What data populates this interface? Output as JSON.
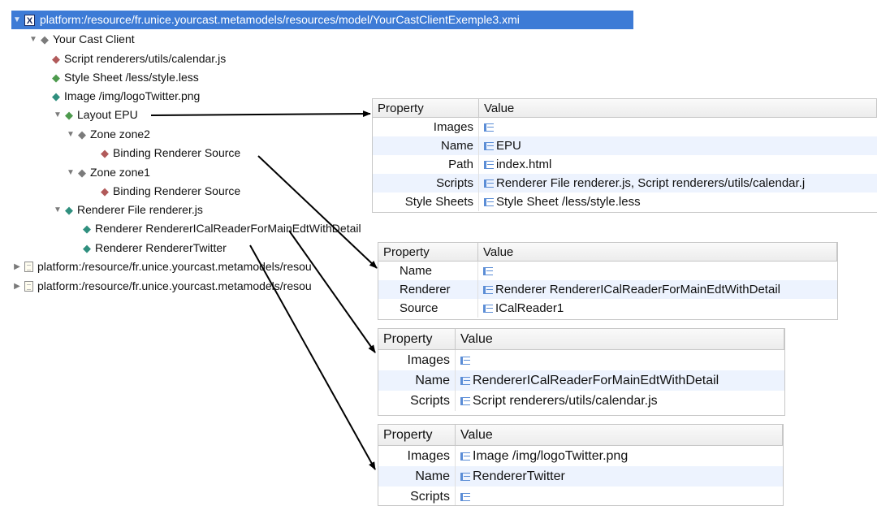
{
  "tree": {
    "root_label": "platform:/resource/fr.unice.yourcast.metamodels/resources/model/YourCastClientExemple3.xmi",
    "client": "Your Cast Client",
    "script": "Script renderers/utils/calendar.js",
    "stylesheet": "Style Sheet /less/style.less",
    "image": "Image /img/logoTwitter.png",
    "layout": "Layout EPU",
    "zone2": "Zone zone2",
    "binding_a": "Binding Renderer Source",
    "zone1": "Zone zone1",
    "binding_b": "Binding Renderer Source",
    "renderer_file": "Renderer File renderer.js",
    "renderer_ical": "Renderer RendererICalReaderForMainEdtWithDetail",
    "renderer_twitter": "Renderer RendererTwitter",
    "other_res_1": "platform:/resource/fr.unice.yourcast.metamodels/resou",
    "other_res_2": "platform:/resource/fr.unice.yourcast.metamodels/resou"
  },
  "panels": {
    "layout": {
      "header_property": "Property",
      "header_value": "Value",
      "rows": [
        {
          "key": "Images",
          "value": ""
        },
        {
          "key": "Name",
          "value": "EPU"
        },
        {
          "key": "Path",
          "value": "index.html"
        },
        {
          "key": "Scripts",
          "value": "Renderer File renderer.js, Script renderers/utils/calendar.j"
        },
        {
          "key": "Style Sheets",
          "value": "Style Sheet /less/style.less"
        }
      ]
    },
    "binding": {
      "header_property": "Property",
      "header_value": "Value",
      "rows": [
        {
          "key": "Name",
          "value": ""
        },
        {
          "key": "Renderer",
          "value": "Renderer RendererICalReaderForMainEdtWithDetail"
        },
        {
          "key": "Source",
          "value": "ICalReader1"
        }
      ]
    },
    "ical": {
      "header_property": "Property",
      "header_value": "Value",
      "rows": [
        {
          "key": "Images",
          "value": ""
        },
        {
          "key": "Name",
          "value": "RendererICalReaderForMainEdtWithDetail"
        },
        {
          "key": "Scripts",
          "value": "Script renderers/utils/calendar.js"
        }
      ]
    },
    "twitter": {
      "header_property": "Property",
      "header_value": "Value",
      "rows": [
        {
          "key": "Images",
          "value": "Image /img/logoTwitter.png"
        },
        {
          "key": "Name",
          "value": "RendererTwitter"
        },
        {
          "key": "Scripts",
          "value": ""
        }
      ]
    }
  },
  "colors": {
    "selection": "#3d7bd6",
    "alt_row": "#edf3fe",
    "arrow": "#000000"
  }
}
